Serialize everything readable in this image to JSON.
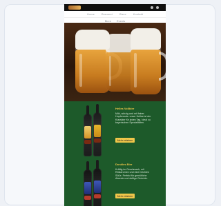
{
  "header": {
    "nav": [
      "Home",
      "Brauerei",
      "Biere",
      "Kontakt"
    ],
    "subnav": [
      "Biere",
      "Events"
    ]
  },
  "hero": {
    "image": "beer-mugs-photo"
  },
  "products": [
    {
      "title": "Helles Vollbier",
      "description": "Mild, würzig und mit feiner Hopfennote: unser Helles ist der Klassiker für jeden Tag. Ideal zu bayerischen Spezialitäten.",
      "button": "Mehr erfahren"
    },
    {
      "title": "Dunkles Bier",
      "description": "Kräftig im Geschmack, mit Röstaromen und einer leichten Süße. Perfekt für gemütliche Abende und deftige Gerichte.",
      "button": "Mehr erfahren"
    }
  ],
  "colors": {
    "brand_green": "#1d5a2a",
    "accent": "#f0c64a"
  }
}
